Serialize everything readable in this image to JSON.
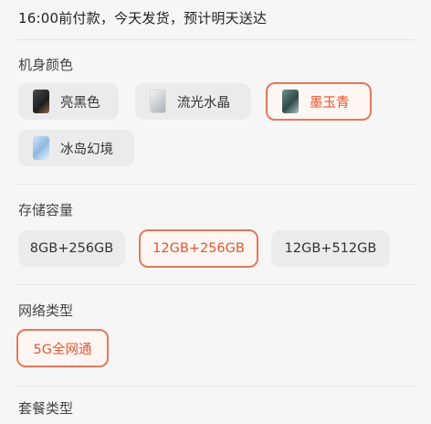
{
  "shipping_note": "16:00前付款，今天发货，预计明天送达",
  "color_section": {
    "title": "机身颜色",
    "options": [
      {
        "label": "亮黑色",
        "icon": "phone-thumb-black-icon",
        "selected": false
      },
      {
        "label": "流光水晶",
        "icon": "phone-thumb-silver-icon",
        "selected": false
      },
      {
        "label": "墨玉青",
        "icon": "phone-thumb-green-icon",
        "selected": true
      },
      {
        "label": "冰岛幻境",
        "icon": "phone-thumb-ice-icon",
        "selected": false
      }
    ]
  },
  "storage_section": {
    "title": "存储容量",
    "options": [
      {
        "label": "8GB+256GB",
        "selected": false
      },
      {
        "label": "12GB+256GB",
        "selected": true
      },
      {
        "label": "12GB+512GB",
        "selected": false
      }
    ]
  },
  "network_section": {
    "title": "网络类型",
    "options": [
      {
        "label": "5G全网通",
        "selected": true
      }
    ]
  },
  "package_section": {
    "title": "套餐类型"
  },
  "colors": {
    "accent": "#e8562f",
    "selected_border": "#e8775a",
    "chip_bg": "#ebebeb",
    "page_bg": "#f6f6f6"
  }
}
